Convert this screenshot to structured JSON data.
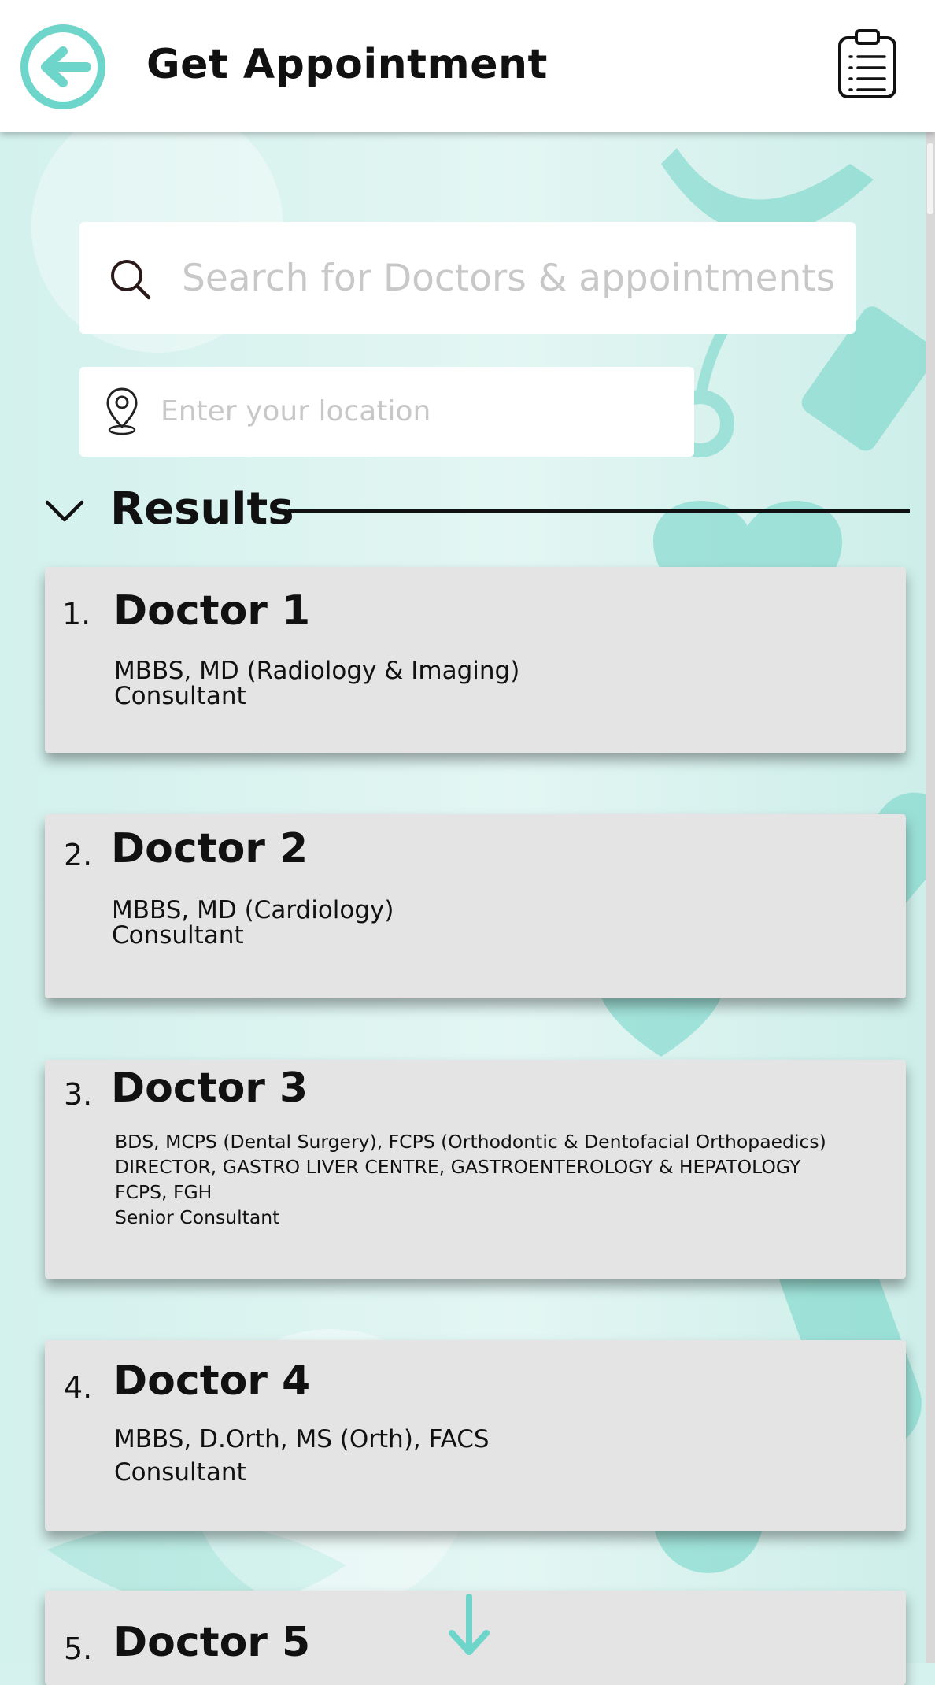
{
  "header": {
    "title": "Get Appointment",
    "back_icon": "arrow-left-circle-icon",
    "clipboard_icon": "clipboard-list-icon",
    "accent_color": "#6dd5c9"
  },
  "search": {
    "placeholder": "Search for Doctors & appointments",
    "icon": "search-icon"
  },
  "location": {
    "placeholder": "Enter your location",
    "icon": "location-pin-icon"
  },
  "results": {
    "heading": "Results",
    "toggle_icon": "chevron-down-icon",
    "doctors": [
      {
        "number": "1.",
        "name": "Doctor 1",
        "lines": [
          "MBBS, MD (Radiology & Imaging)",
          "Consultant"
        ]
      },
      {
        "number": "2.",
        "name": "Doctor 2",
        "lines": [
          "MBBS, MD (Cardiology)",
          "Consultant"
        ]
      },
      {
        "number": "3.",
        "name": "Doctor 3",
        "lines": [
          "BDS, MCPS (Dental Surgery), FCPS (Orthodontic & Dentofacial Orthopaedics)",
          "DIRECTOR, GASTRO LIVER CENTRE, GASTROENTEROLOGY & HEPATOLOGY",
          "FCPS, FGH",
          "Senior Consultant"
        ]
      },
      {
        "number": "4.",
        "name": "Doctor 4",
        "lines": [
          "MBBS, D.Orth, MS (Orth), FACS",
          "Consultant"
        ]
      },
      {
        "number": "5.",
        "name": "Doctor 5",
        "lines": []
      }
    ]
  },
  "scroll_down_icon": "arrow-down-icon"
}
